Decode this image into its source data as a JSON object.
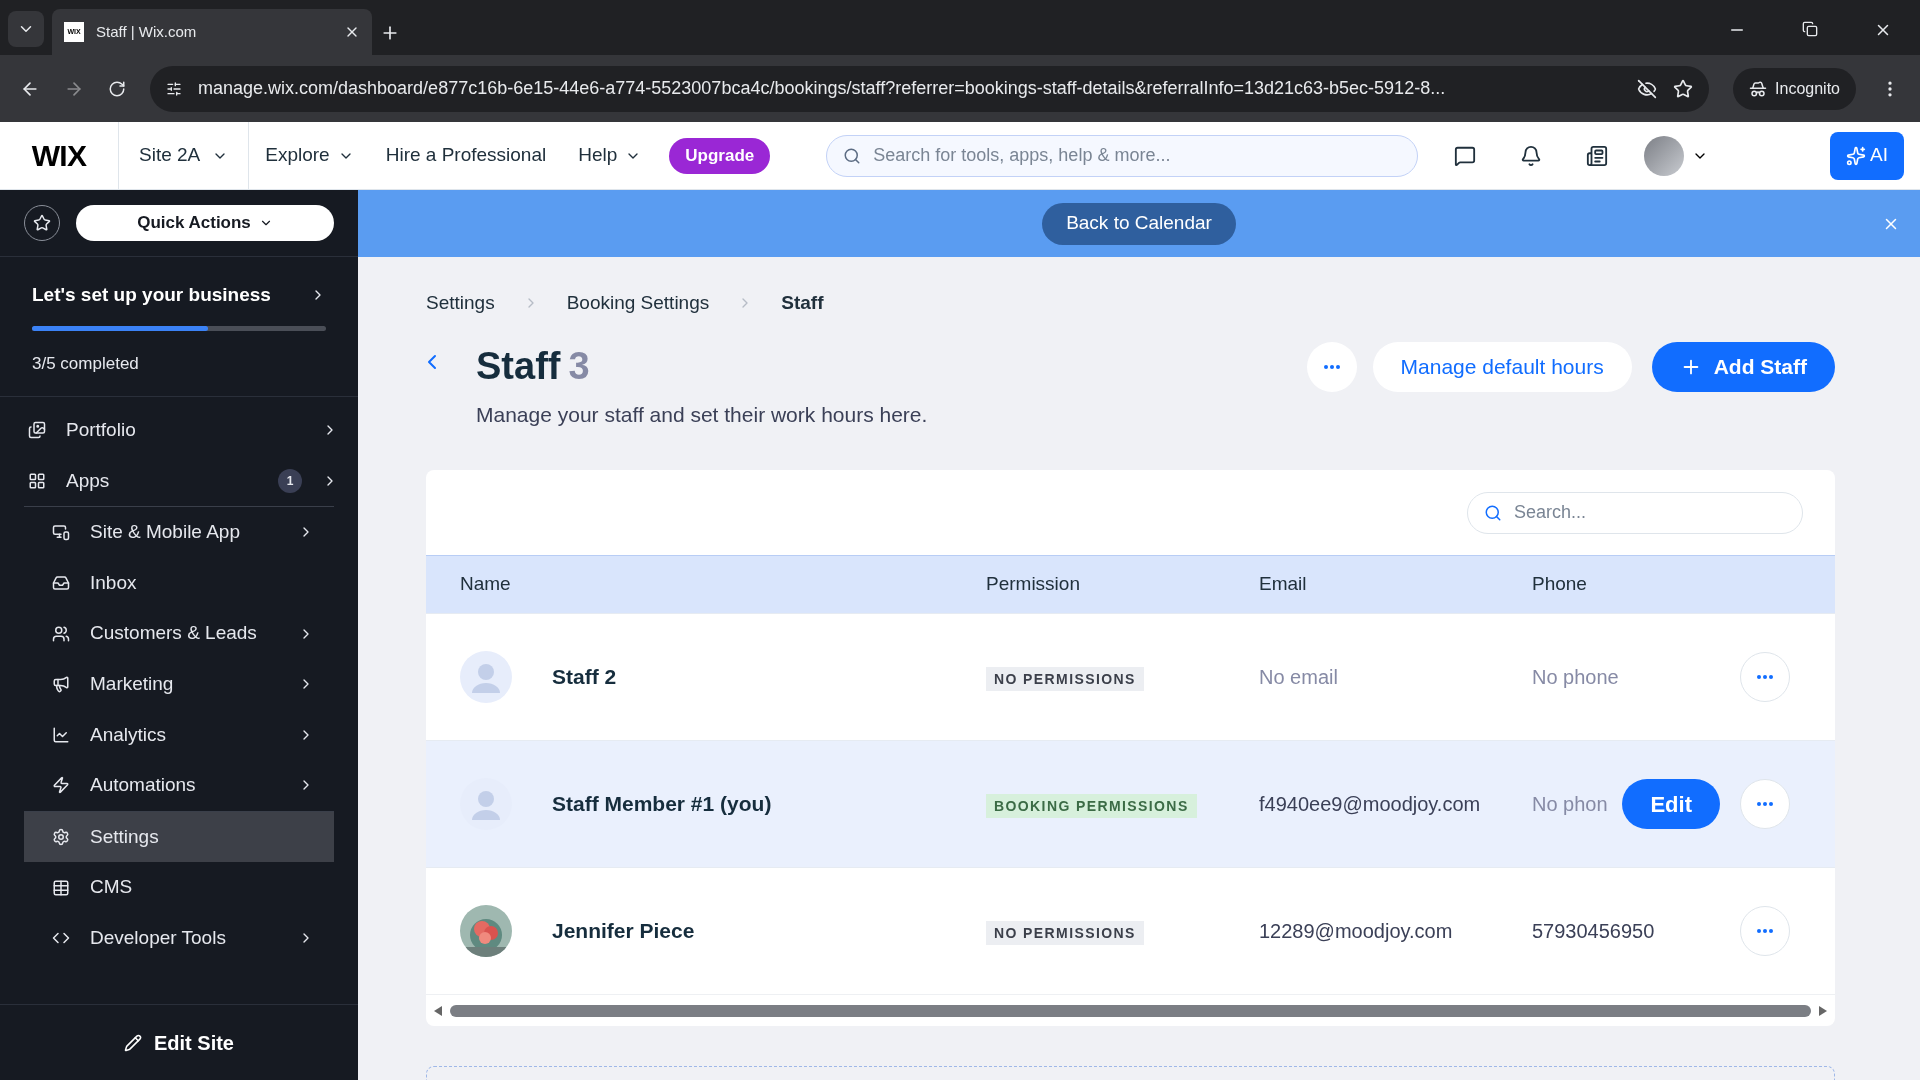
{
  "browser": {
    "tab": {
      "title": "Staff | Wix.com",
      "favicon": "WIX"
    },
    "url": "manage.wix.com/dashboard/e877c16b-6e15-44e6-a774-5523007bca4c/bookings/staff?referrer=bookings-staff-details&referralInfo=13d21c63-b5ec-5912-8...",
    "profile": "Incognito"
  },
  "topbar": {
    "logo": "WIX",
    "site": "Site 2A",
    "nav": [
      {
        "label": "Explore",
        "dropdown": true
      },
      {
        "label": "Hire a Professional",
        "dropdown": false
      },
      {
        "label": "Help",
        "dropdown": true
      }
    ],
    "upgrade": "Upgrade",
    "search_placeholder": "Search for tools, apps, help & more...",
    "ai": "AI"
  },
  "sidebar": {
    "quick_actions": "Quick Actions",
    "setup": {
      "title": "Let's set up your business",
      "level": 0.6,
      "progress": "3/5 completed"
    },
    "groups": [
      [
        {
          "label": "Portfolio",
          "submenu": true,
          "selected": false
        },
        {
          "label": "Apps",
          "badge": "1",
          "submenu": true,
          "selected": false
        }
      ],
      [
        {
          "label": "Site & Mobile App",
          "submenu": true,
          "selected": false
        },
        {
          "label": "Inbox",
          "submenu": false,
          "selected": false
        },
        {
          "label": "Customers & Leads",
          "submenu": true,
          "selected": false
        },
        {
          "label": "Marketing",
          "submenu": true,
          "selected": false
        },
        {
          "label": "Analytics",
          "submenu": true,
          "selected": false
        },
        {
          "label": "Automations",
          "submenu": true,
          "selected": false
        }
      ],
      [
        {
          "label": "Settings",
          "submenu": false,
          "selected": true
        },
        {
          "label": "CMS",
          "submenu": false,
          "selected": false
        },
        {
          "label": "Developer Tools",
          "submenu": true,
          "selected": false
        }
      ]
    ],
    "edit_site": "Edit Site"
  },
  "banner": {
    "button": "Back to Calendar"
  },
  "breadcrumbs": [
    "Settings",
    "Booking Settings",
    "Staff"
  ],
  "page": {
    "title": "Staff",
    "count": "3",
    "subtitle": "Manage your staff and set their work hours here.",
    "secondary_button": "Manage default hours",
    "primary_button": "Add Staff"
  },
  "table": {
    "search_placeholder": "Search...",
    "columns": [
      "Name",
      "Permission",
      "Email",
      "Phone"
    ],
    "rows": [
      {
        "kind": "placeholder",
        "name": "Staff 2",
        "permission": {
          "text": "NO PERMISSIONS",
          "kind": "none"
        },
        "email": "No email",
        "email_empty": true,
        "phone": "No phone",
        "phone_empty": true,
        "hovered": false
      },
      {
        "kind": "placeholder",
        "name": "Staff Member #1 (you)",
        "permission": {
          "text": "BOOKING PERMISSIONS",
          "kind": "booking"
        },
        "email": "f4940ee9@moodjoy.com",
        "email_empty": false,
        "phone": "No phon",
        "phone_empty": true,
        "hovered": true,
        "action": "Edit"
      },
      {
        "kind": "picture",
        "name": "Jennifer Piece",
        "permission": {
          "text": "NO PERMISSIONS",
          "kind": "none"
        },
        "email": "12289@moodjoy.com",
        "email_empty": false,
        "phone": "57930456950",
        "phone_empty": false,
        "hovered": false
      }
    ]
  }
}
